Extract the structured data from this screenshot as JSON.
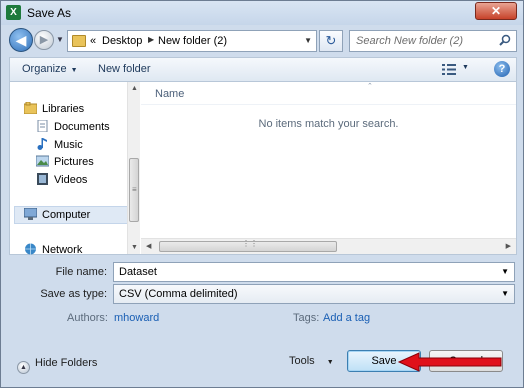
{
  "window": {
    "title": "Save As",
    "close_glyph": "✕"
  },
  "address_bar": {
    "overflow": "«",
    "parts": [
      "Desktop",
      "New folder (2)"
    ],
    "search_placeholder": "Search New folder (2)"
  },
  "toolbar": {
    "organize_label": "Organize",
    "new_folder_label": "New folder"
  },
  "nav_pane": {
    "items": [
      {
        "label": "Libraries",
        "icon": "libraries-icon"
      },
      {
        "label": "Documents",
        "icon": "documents-icon"
      },
      {
        "label": "Music",
        "icon": "music-icon"
      },
      {
        "label": "Pictures",
        "icon": "pictures-icon"
      },
      {
        "label": "Videos",
        "icon": "videos-icon"
      },
      {
        "label": "Computer",
        "icon": "computer-icon"
      },
      {
        "label": "Network",
        "icon": "network-icon"
      }
    ],
    "selected": "Computer"
  },
  "file_list": {
    "column_name": "Name",
    "empty_message": "No items match your search."
  },
  "form": {
    "file_name_label": "File name:",
    "file_name_value": "Dataset",
    "save_as_type_label": "Save as type:",
    "save_as_type_value": "CSV (Comma delimited)",
    "authors_label": "Authors:",
    "authors_value": "mhoward",
    "tags_label": "Tags:",
    "tags_value": "Add a tag"
  },
  "footer": {
    "hide_folders_label": "Hide Folders",
    "tools_label": "Tools",
    "save_label": "Save",
    "cancel_label": "Cancel"
  },
  "colors": {
    "annotation_arrow": "#e0101a",
    "link": "#1a5fb4"
  }
}
